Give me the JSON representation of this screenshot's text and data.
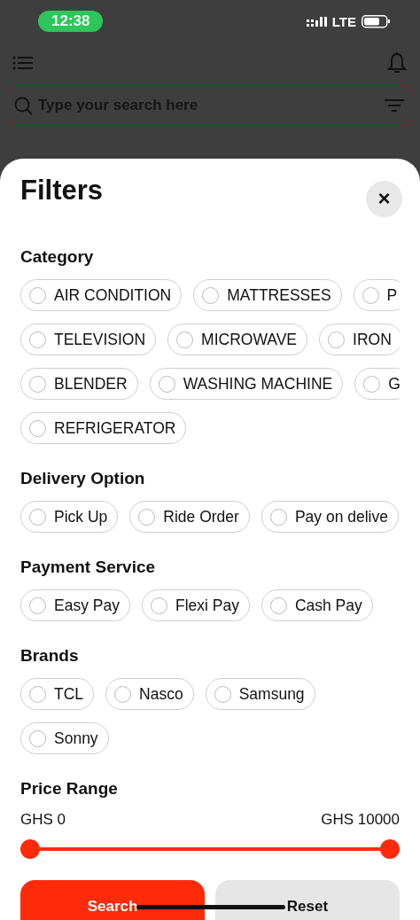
{
  "status_bar": {
    "time": "12:38",
    "network": "LTE"
  },
  "search": {
    "placeholder": "Type your search here"
  },
  "filters": {
    "title": "Filters",
    "close": "×",
    "sections": [
      {
        "kind": "chips",
        "heading": "Category",
        "rows": [
          [
            {
              "label": "AIR CONDITION",
              "selected": false
            },
            {
              "label": "MATTRESSES",
              "selected": false
            },
            {
              "label": "P",
              "selected": false
            }
          ],
          [
            {
              "label": "TELEVISION",
              "selected": false
            },
            {
              "label": "MICROWAVE",
              "selected": false
            },
            {
              "label": "IRON",
              "selected": false
            }
          ],
          [
            {
              "label": "BLENDER",
              "selected": false
            },
            {
              "label": "WASHING MACHINE",
              "selected": false
            },
            {
              "label": "G",
              "selected": false
            }
          ],
          [
            {
              "label": "REFRIGERATOR",
              "selected": false
            }
          ]
        ]
      },
      {
        "kind": "chips",
        "heading": "Delivery Option",
        "rows": [
          [
            {
              "label": "Pick Up",
              "selected": false
            },
            {
              "label": "Ride Order",
              "selected": false
            },
            {
              "label": "Pay on delive",
              "selected": false
            }
          ]
        ]
      },
      {
        "kind": "chips",
        "heading": "Payment Service",
        "rows": [
          [
            {
              "label": "Easy Pay",
              "selected": false
            },
            {
              "label": "Flexi Pay",
              "selected": false
            },
            {
              "label": "Cash Pay",
              "selected": false
            }
          ]
        ]
      },
      {
        "kind": "chips",
        "heading": "Brands",
        "rows": [
          [
            {
              "label": "TCL",
              "selected": false
            },
            {
              "label": "Nasco",
              "selected": false
            },
            {
              "label": "Samsung",
              "selected": false
            }
          ],
          [
            {
              "label": "Sonny",
              "selected": false
            }
          ]
        ]
      },
      {
        "kind": "range",
        "heading": "Price Range",
        "min_label": "GHS 0",
        "max_label": "GHS 10000"
      }
    ],
    "buttons": [
      {
        "label": "Search",
        "kind": "primary"
      },
      {
        "label": "Reset",
        "kind": "secondary"
      }
    ]
  }
}
